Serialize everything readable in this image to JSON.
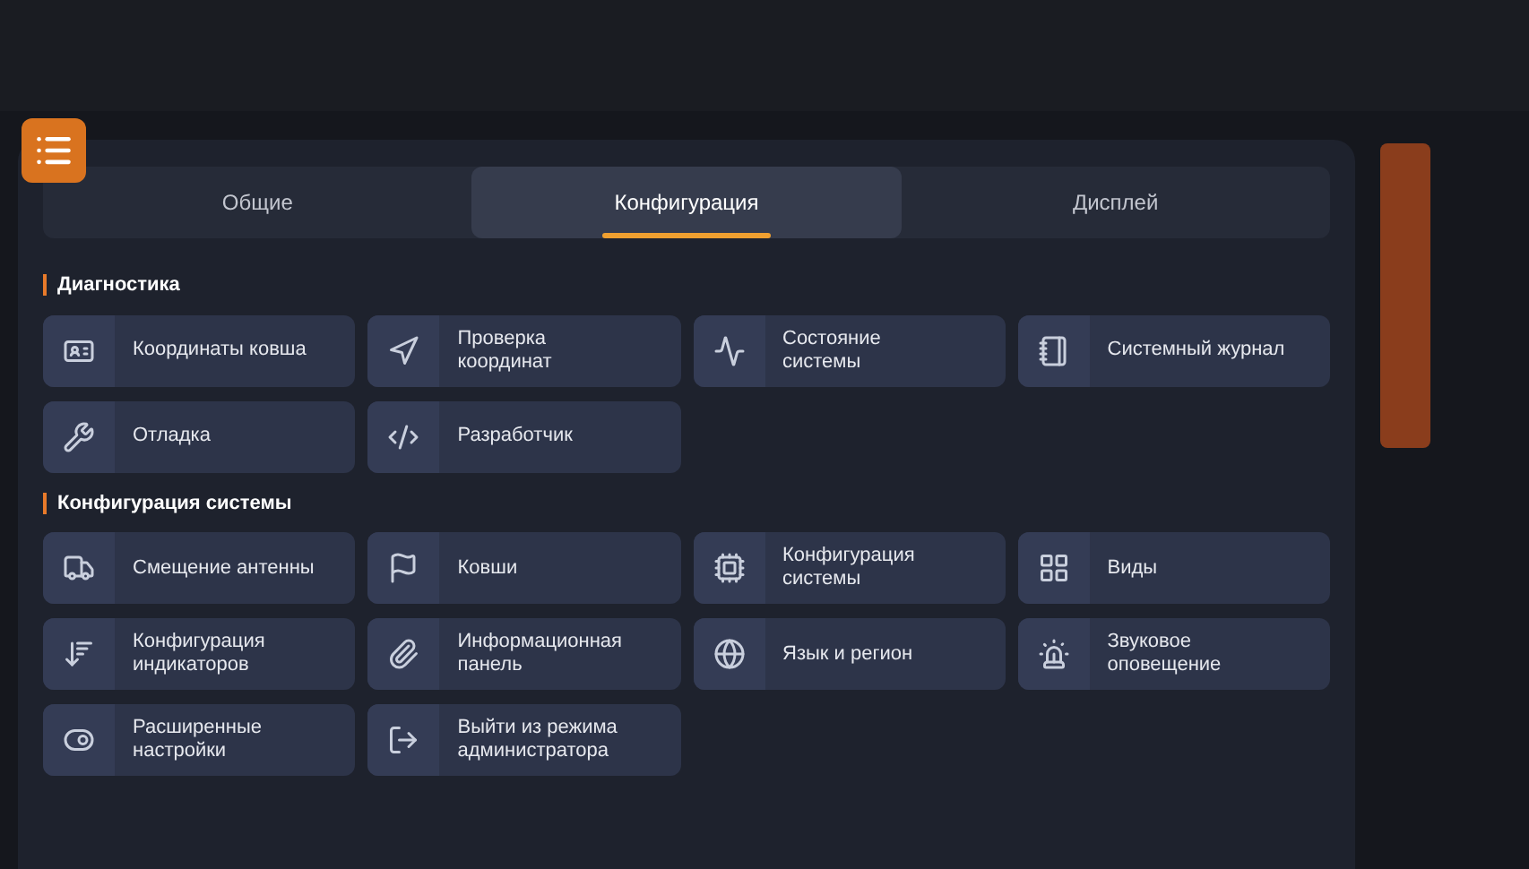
{
  "tabs": [
    {
      "label": "Общие",
      "selected": false
    },
    {
      "label": "Конфигурация",
      "selected": true
    },
    {
      "label": "Дисплей",
      "selected": false
    }
  ],
  "sections": [
    {
      "title": "Диагностика",
      "items": [
        {
          "label": "Координаты ковша"
        },
        {
          "label": "Проверка\nкоординат"
        },
        {
          "label": "Состояние\nсистемы"
        },
        {
          "label": "Системный журнал"
        },
        {
          "label": "Отладка"
        },
        {
          "label": "Разработчик"
        }
      ]
    },
    {
      "title": "Конфигурация системы",
      "items": [
        {
          "label": "Смещение антенны"
        },
        {
          "label": "Ковши"
        },
        {
          "label": "Конфигурация системы"
        },
        {
          "label": "Виды"
        },
        {
          "label": "Конфигурация индикаторов"
        },
        {
          "label": "Информационная панель"
        },
        {
          "label": "Язык и регион"
        },
        {
          "label": "Звуковое\nоповещение"
        },
        {
          "label": "Расширенные настройки"
        },
        {
          "label": "Выйти из режима администратора"
        }
      ]
    }
  ]
}
